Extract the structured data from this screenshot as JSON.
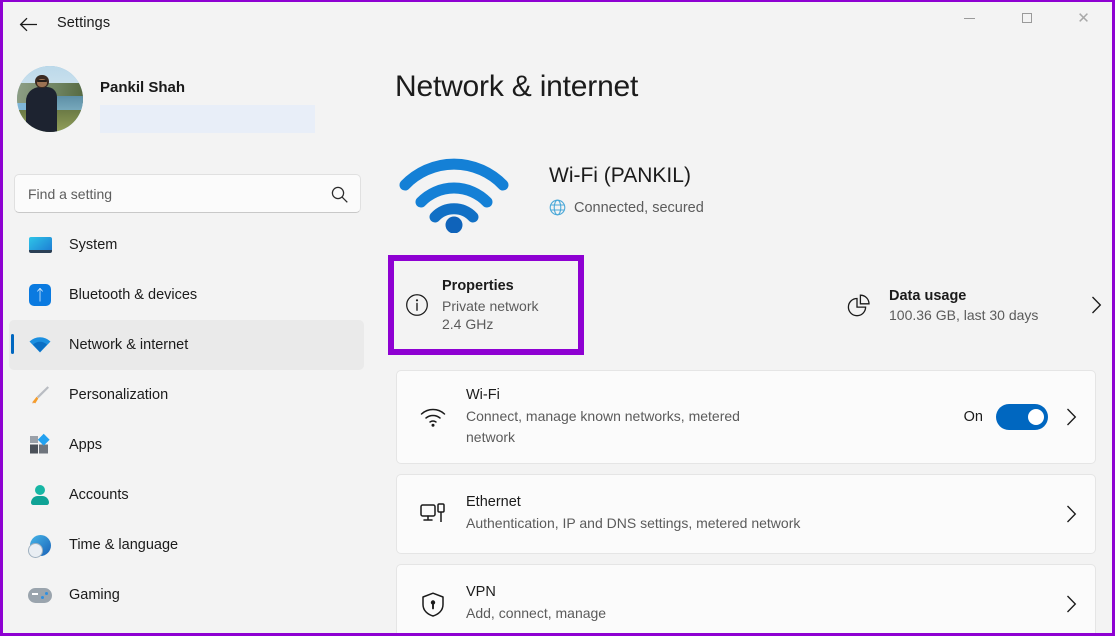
{
  "window": {
    "title": "Settings",
    "back_icon": "back-arrow-icon",
    "controls": {
      "minimize": "minimize-icon",
      "maximize": "maximize-icon",
      "close": "close-icon"
    }
  },
  "sidebar": {
    "profile": {
      "name": "Pankil Shah",
      "email_redacted": ""
    },
    "search": {
      "placeholder": "Find a setting",
      "value": "Find a setting",
      "icon": "search-icon"
    },
    "items": [
      {
        "label": "System",
        "icon": "system-icon",
        "selected": false
      },
      {
        "label": "Bluetooth & devices",
        "icon": "bluetooth-icon",
        "selected": false
      },
      {
        "label": "Network & internet",
        "icon": "network-wifi-icon",
        "selected": true
      },
      {
        "label": "Personalization",
        "icon": "paintbrush-icon",
        "selected": false
      },
      {
        "label": "Apps",
        "icon": "apps-icon",
        "selected": false
      },
      {
        "label": "Accounts",
        "icon": "accounts-person-icon",
        "selected": false
      },
      {
        "label": "Time & language",
        "icon": "clock-globe-icon",
        "selected": false
      },
      {
        "label": "Gaming",
        "icon": "gamepad-icon",
        "selected": false
      }
    ]
  },
  "main": {
    "page_title": "Network & internet",
    "status": {
      "icon": "wifi-signal-icon",
      "name": "Wi-Fi (PANKIL)",
      "sub_icon": "globe-icon",
      "sub": "Connected, secured"
    },
    "properties": {
      "icon": "info-circle-icon",
      "title": "Properties",
      "line1": "Private network",
      "line2": "2.4 GHz",
      "highlight_color": "#8e00d2",
      "highlighted": true
    },
    "data_usage": {
      "icon": "pie-chart-icon",
      "title": "Data usage",
      "sub": "100.36 GB, last 30 days",
      "chevron": "chevron-right-icon"
    },
    "cards": [
      {
        "id": "wifi",
        "icon": "wifi-icon",
        "title": "Wi-Fi",
        "sub": "Connect, manage known networks, metered network",
        "toggle_label": "On",
        "toggle_on": true,
        "toggle_color": "#0067c0",
        "chevron": "chevron-right-icon"
      },
      {
        "id": "ethernet",
        "icon": "ethernet-icon",
        "title": "Ethernet",
        "sub": "Authentication, IP and DNS settings, metered network",
        "chevron": "chevron-right-icon"
      },
      {
        "id": "vpn",
        "icon": "vpn-shield-icon",
        "title": "VPN",
        "sub": "Add, connect, manage",
        "chevron": "chevron-right-icon"
      }
    ]
  }
}
